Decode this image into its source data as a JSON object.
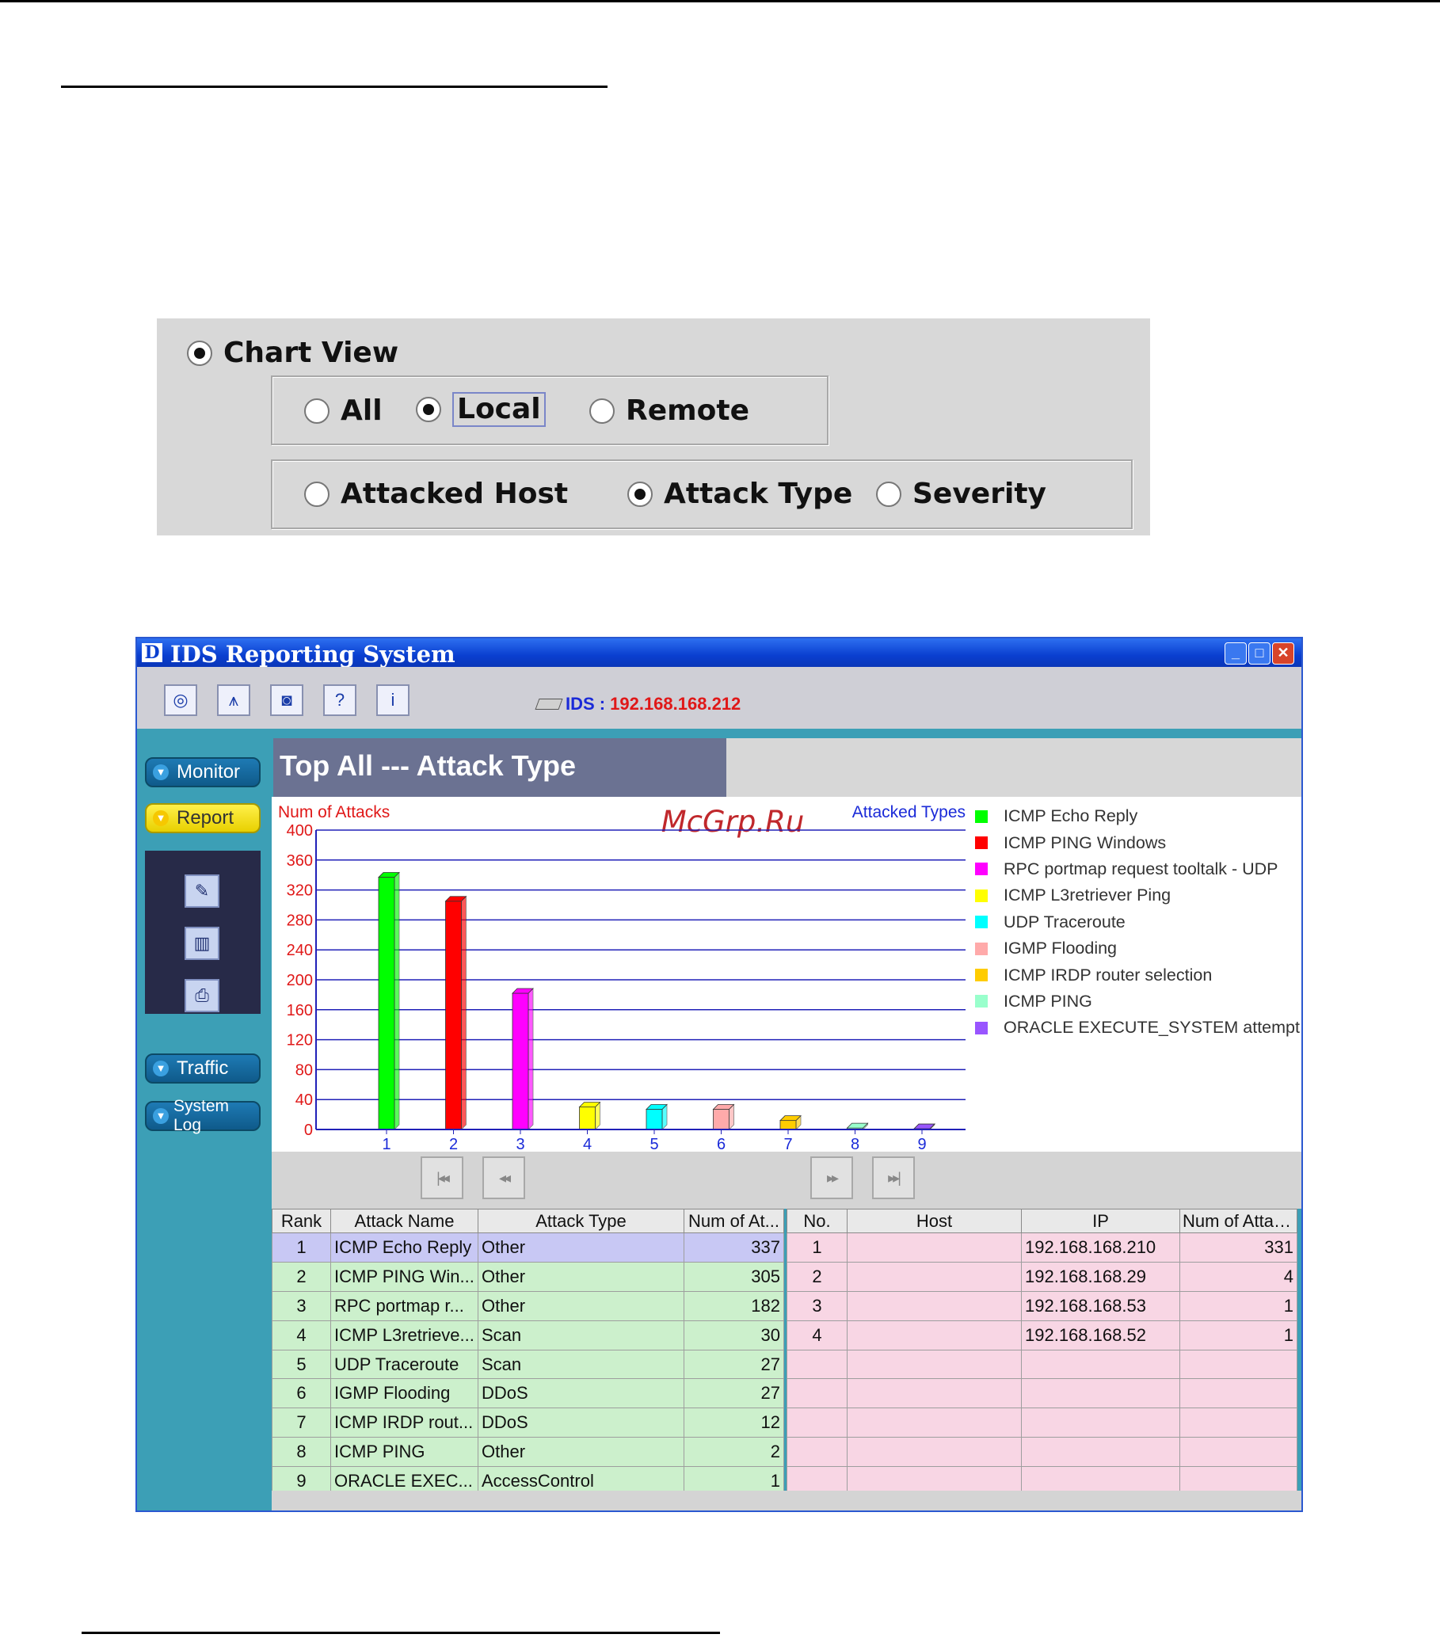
{
  "chart_view": {
    "label": "Chart View",
    "scope_options": [
      {
        "label": "All",
        "selected": false
      },
      {
        "label": "Local",
        "selected": true
      },
      {
        "label": "Remote",
        "selected": false
      }
    ],
    "category_options": [
      {
        "label": "Attacked Host",
        "selected": false
      },
      {
        "label": "Attack Type",
        "selected": true
      },
      {
        "label": "Severity",
        "selected": false
      }
    ]
  },
  "window": {
    "logo": "D",
    "title": "IDS Reporting System",
    "toolbar_icons": [
      "globe-icon",
      "tower-icon",
      "camera-icon",
      "help-icon",
      "info-icon"
    ],
    "ids_label": "IDS :",
    "ids_ip": "192.168.168.212"
  },
  "nav": {
    "items": [
      {
        "label": "Monitor",
        "active": false
      },
      {
        "label": "Report",
        "active": true
      },
      {
        "label": "Traffic",
        "active": false
      },
      {
        "label": "System Log",
        "active": false
      }
    ],
    "sub_icons": [
      "report-view-icon",
      "report-chart-icon",
      "print-icon"
    ]
  },
  "page_title": "Top All  --- Attack Type",
  "watermark": "McGrp.Ru",
  "chart_data": {
    "type": "bar",
    "ylabel": "Num of Attacks",
    "legend_title": "Attacked Types",
    "categories": [
      "1",
      "2",
      "3",
      "4",
      "5",
      "6",
      "7",
      "8",
      "9"
    ],
    "values": [
      337,
      305,
      182,
      30,
      27,
      27,
      12,
      2,
      1
    ],
    "ylim": [
      0,
      400
    ],
    "yticks": [
      0,
      40,
      80,
      120,
      160,
      200,
      240,
      280,
      320,
      360,
      400
    ],
    "grid": true,
    "legend_position": "right",
    "colors": [
      "#00ff00",
      "#ff0000",
      "#ff00ff",
      "#ffff00",
      "#00ffff",
      "#ffaaaa",
      "#ffcc00",
      "#99ffcc",
      "#9955ff"
    ],
    "series": [
      {
        "name": "ICMP Echo Reply"
      },
      {
        "name": "ICMP PING Windows"
      },
      {
        "name": "RPC portmap request tooltalk - UDP"
      },
      {
        "name": "ICMP L3retriever Ping"
      },
      {
        "name": "UDP Traceroute"
      },
      {
        "name": "IGMP Flooding"
      },
      {
        "name": "ICMP IRDP router selection"
      },
      {
        "name": "ICMP PING"
      },
      {
        "name": "ORACLE EXECUTE_SYSTEM attempt"
      }
    ]
  },
  "attack_table": {
    "columns": [
      "Rank",
      "Attack Name",
      "Attack Type",
      "Num of At..."
    ],
    "rows": [
      [
        "1",
        "ICMP Echo Reply",
        "Other",
        "337"
      ],
      [
        "2",
        "ICMP PING Win...",
        "Other",
        "305"
      ],
      [
        "3",
        "RPC portmap r...",
        "Other",
        "182"
      ],
      [
        "4",
        "ICMP L3retrieve...",
        "Scan",
        "30"
      ],
      [
        "5",
        "UDP Traceroute",
        "Scan",
        "27"
      ],
      [
        "6",
        "IGMP Flooding",
        "DDoS",
        "27"
      ],
      [
        "7",
        "ICMP IRDP rout...",
        "DDoS",
        "12"
      ],
      [
        "8",
        "ICMP PING",
        "Other",
        "2"
      ],
      [
        "9",
        "ORACLE EXEC...",
        "AccessControl",
        "1"
      ]
    ]
  },
  "host_table": {
    "columns": [
      "No.",
      "Host",
      "IP",
      "Num of Attac..."
    ],
    "rows": [
      [
        "1",
        "",
        "192.168.168.210",
        "331"
      ],
      [
        "2",
        "",
        "192.168.168.29",
        "4"
      ],
      [
        "3",
        "",
        "192.168.168.53",
        "1"
      ],
      [
        "4",
        "",
        "192.168.168.52",
        "1"
      ],
      [
        "",
        "",
        "",
        ""
      ],
      [
        "",
        "",
        "",
        ""
      ],
      [
        "",
        "",
        "",
        ""
      ],
      [
        "",
        "",
        "",
        ""
      ],
      [
        "",
        "",
        "",
        ""
      ]
    ]
  }
}
